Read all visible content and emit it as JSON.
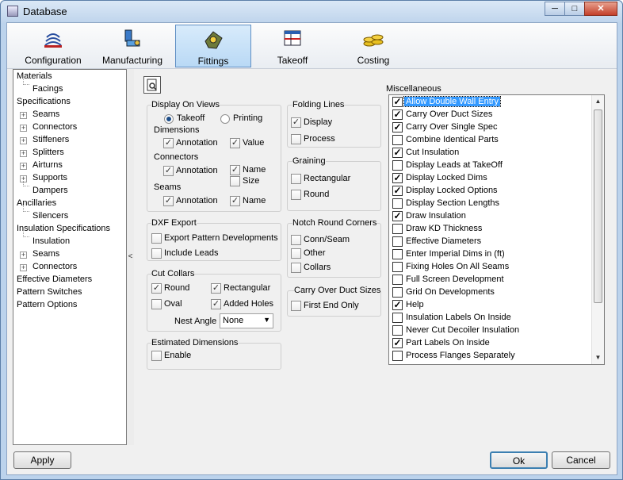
{
  "window": {
    "title": "Database",
    "minimize": "─",
    "maximize": "□",
    "close": "✕"
  },
  "toolbar": {
    "tabs": [
      {
        "label": "Configuration",
        "icon": "configuration-icon"
      },
      {
        "label": "Manufacturing",
        "icon": "manufacturing-icon"
      },
      {
        "label": "Fittings",
        "icon": "fittings-icon",
        "active": true
      },
      {
        "label": "Takeoff",
        "icon": "takeoff-icon"
      },
      {
        "label": "Costing",
        "icon": "costing-icon"
      }
    ]
  },
  "tree": {
    "items": [
      {
        "label": "Materials"
      },
      {
        "label": "Facings"
      },
      {
        "label": "Specifications"
      },
      {
        "label": "Seams",
        "expand": "+"
      },
      {
        "label": "Connectors",
        "expand": "+"
      },
      {
        "label": "Stiffeners",
        "expand": "+"
      },
      {
        "label": "Splitters",
        "expand": "+"
      },
      {
        "label": "Airturns",
        "expand": "+"
      },
      {
        "label": "Supports",
        "expand": "+"
      },
      {
        "label": "Dampers"
      },
      {
        "label": "Ancillaries"
      },
      {
        "label": "Silencers"
      },
      {
        "label": "Insulation Specifications"
      },
      {
        "label": "Insulation"
      },
      {
        "label": "Seams",
        "expand": "+"
      },
      {
        "label": "Connectors",
        "expand": "+"
      },
      {
        "label": "Effective Diameters"
      },
      {
        "label": "Pattern Switches"
      },
      {
        "label": "Pattern Options"
      }
    ]
  },
  "splitter": {
    "glyph": "<"
  },
  "display_on_views": {
    "title": "Display On Views",
    "takeoff": "Takeoff",
    "printing": "Printing",
    "dimensions": "Dimensions",
    "dim_annotation": "Annotation",
    "dim_value": "Value",
    "connectors": "Connectors",
    "conn_annotation": "Annotation",
    "conn_name": "Name",
    "conn_size": "Size",
    "seams": "Seams",
    "seam_annotation": "Annotation",
    "seam_name": "Name",
    "check": "✓"
  },
  "dxf_export": {
    "title": "DXF Export",
    "export_pattern": "Export Pattern Developments",
    "include_leads": "Include Leads"
  },
  "cut_collars": {
    "title": "Cut Collars",
    "round": "Round",
    "rectangular": "Rectangular",
    "oval": "Oval",
    "added_holes": "Added Holes",
    "nest_angle": "Nest Angle",
    "nest_value": "None",
    "arrow": "▼"
  },
  "estimated_dimensions": {
    "title": "Estimated Dimensions",
    "enable": "Enable"
  },
  "folding_lines": {
    "title": "Folding Lines",
    "display": "Display",
    "process": "Process"
  },
  "graining": {
    "title": "Graining",
    "rectangular": "Rectangular",
    "round": "Round"
  },
  "notch_round_corners": {
    "title": "Notch Round Corners",
    "conn_seam": "Conn/Seam",
    "other": "Other",
    "collars": "Collars"
  },
  "carry_over": {
    "title": "Carry Over Duct Sizes",
    "first_end_only": "First End Only"
  },
  "misc": {
    "title": "Miscellaneous",
    "items": [
      {
        "label": "Allow Double Wall Entry",
        "checked": true,
        "selected": true
      },
      {
        "label": "Carry Over Duct Sizes",
        "checked": true
      },
      {
        "label": "Carry Over Single Spec",
        "checked": true
      },
      {
        "label": "Combine Identical Parts",
        "checked": false
      },
      {
        "label": "Cut Insulation",
        "checked": true
      },
      {
        "label": "Display Leads at TakeOff",
        "checked": false
      },
      {
        "label": "Display Locked Dims",
        "checked": true
      },
      {
        "label": "Display Locked Options",
        "checked": true
      },
      {
        "label": "Display Section Lengths",
        "checked": false
      },
      {
        "label": "Draw Insulation",
        "checked": true
      },
      {
        "label": "Draw KD Thickness",
        "checked": false
      },
      {
        "label": "Effective Diameters",
        "checked": false
      },
      {
        "label": "Enter Imperial Dims in (ft)",
        "checked": false
      },
      {
        "label": "Fixing Holes On All Seams",
        "checked": false
      },
      {
        "label": "Full Screen Development",
        "checked": false
      },
      {
        "label": "Grid On Developments",
        "checked": false
      },
      {
        "label": "Help",
        "checked": true
      },
      {
        "label": "Insulation Labels On Inside",
        "checked": false
      },
      {
        "label": "Never Cut Decoiler Insulation",
        "checked": false
      },
      {
        "label": "Part Labels On Inside",
        "checked": true
      },
      {
        "label": "Process Flanges Separately",
        "checked": false
      }
    ],
    "up": "▲",
    "down": "▼"
  },
  "footer": {
    "apply": "Apply",
    "ok": "Ok",
    "cancel": "Cancel"
  }
}
